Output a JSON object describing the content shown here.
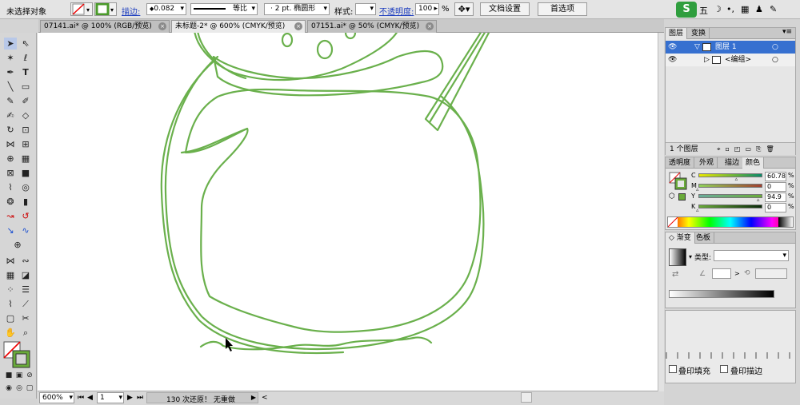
{
  "control_bar": {
    "selection_status": "未选择对象",
    "stroke_label": "描边:",
    "stroke_weight": "0.082",
    "profile": "等比",
    "brush": "2 pt. 椭圆形",
    "style_label": "样式:",
    "opacity_label": "不透明度:",
    "opacity_value": "100",
    "percent": "%",
    "doc_setup": "文档设置",
    "preferences": "首选项"
  },
  "ime": {
    "brand": "S",
    "mode": "五",
    "moon": "☽",
    "dot": "•,",
    "kbd": "▦",
    "shirt": "♟",
    "wrench": "✎"
  },
  "tabs": [
    {
      "label": "07141.ai* @ 100% (RGB/预览)"
    },
    {
      "label": "未标题-2* @ 600% (CMYK/预览)"
    },
    {
      "label": "07151.ai* @ 50% (CMYK/预览)"
    }
  ],
  "tab_close": "×",
  "status": {
    "zoom": "600%",
    "page": "1",
    "undo_info": "130 次还原！ 无重做",
    "arrow": "▶",
    "back": "<"
  },
  "layers": {
    "tabs": [
      "图层",
      "变换"
    ],
    "layer_name": "图层 1",
    "group_name": "<编组>",
    "count": "1 个图层"
  },
  "color_panel": {
    "tabs": [
      "透明度",
      "外观",
      "描边",
      "颜色"
    ],
    "channels": [
      {
        "label": "C",
        "value": "60.78",
        "fraction": 0.6078
      },
      {
        "label": "M",
        "value": "0",
        "fraction": 0
      },
      {
        "label": "Y",
        "value": "94.9",
        "fraction": 0.949
      },
      {
        "label": "K",
        "value": "0",
        "fraction": 0
      }
    ],
    "percent": "%",
    "fill_color": "#6aab3a",
    "stroke_color": "#6aab3a"
  },
  "gradient_panel": {
    "tabs": [
      "渐变",
      "色板"
    ],
    "type_label": "类型:"
  },
  "attributes": {
    "overprint_fill": "叠印填充",
    "overprint_stroke": "叠印描边"
  },
  "colors": {
    "accent_selection": "#3670d0",
    "stroke_green": "#6ab04c"
  },
  "tool_icons": [
    "selection-arrow",
    "direct-selection",
    "magic-wand",
    "lasso",
    "pen",
    "type",
    "line",
    "rectangle",
    "paintbrush",
    "pencil",
    "blob-brush",
    "eraser",
    "rotate",
    "scale",
    "width",
    "free-transform",
    "shape-builder",
    "perspective",
    "mesh",
    "gradient",
    "eyedropper",
    "blend",
    "symbol-sprayer",
    "column-graph",
    "artboard",
    "slice",
    "hand",
    "zoom"
  ]
}
